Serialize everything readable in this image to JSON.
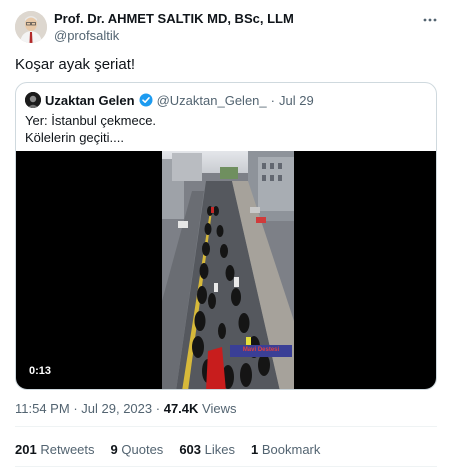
{
  "author": {
    "name": "Prof. Dr. AHMET SALTIK MD, BSc, LLM",
    "handle": "@profsaltik"
  },
  "tweet": {
    "text": "Koşar ayak şeriat!"
  },
  "quote": {
    "name": "Uzaktan Gelen",
    "handle": "@Uzaktan_Gelen_",
    "separator": "·",
    "date": "Jul 29",
    "text_line1": "Yer: İstanbul çekmece.",
    "text_line2": "Kölelerin geçiti....",
    "video_duration": "0:13",
    "video_banner_text": "Mavi Destesi"
  },
  "meta": {
    "time": "11:54 PM",
    "separator": "·",
    "date": "Jul 29, 2023",
    "views_count": "47.4K",
    "views_label": "Views"
  },
  "stats": [
    {
      "count": "201",
      "label": "Retweets"
    },
    {
      "count": "9",
      "label": "Quotes"
    },
    {
      "count": "603",
      "label": "Likes"
    },
    {
      "count": "1",
      "label": "Bookmark"
    }
  ],
  "colors": {
    "text_primary": "#0f1419",
    "text_secondary": "#536471",
    "verified_blue": "#1d9bf0",
    "border": "#cfd9de"
  },
  "icons": {
    "more": "more-horizontal-icon",
    "verified": "verified-badge-icon"
  }
}
